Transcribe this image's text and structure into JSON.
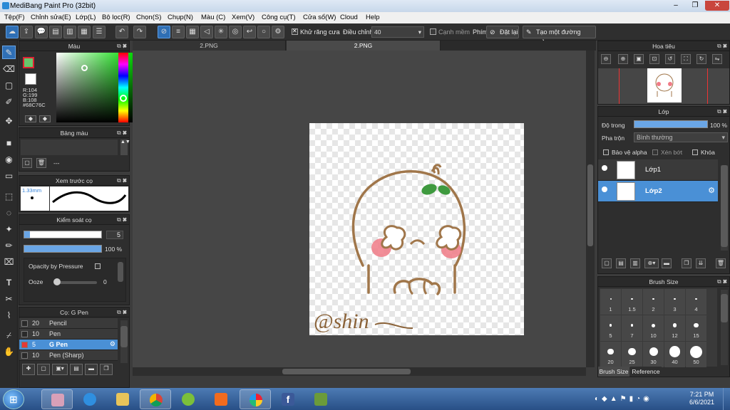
{
  "window": {
    "title": "MediBang Paint Pro (32bit)",
    "min": "–",
    "max": "❐",
    "close": "✕"
  },
  "menu": [
    "Tệp(F)",
    "Chỉnh sửa(E)",
    "Lớp(L)",
    "Bộ lọc(R)",
    "Chọn(S)",
    "Chụp(N)",
    "Màu (C)",
    "Xem(V)",
    "Công cụ(T)",
    "Cửa sổ(W)",
    "Cloud",
    "Help"
  ],
  "toolbar": {
    "antialias_label": "Khử răng cưa",
    "adjust_label": "Điều chỉnh",
    "adjust_value": "40",
    "edge_label": "Cạnh mềm",
    "key_label": "Phím",
    "reset_label": "Đặt lại",
    "straight_label": "Tạo một đường thẳng"
  },
  "color_panel": {
    "title": "Màu",
    "r": "R:104",
    "g": "G:199",
    "b": "B:108",
    "hex": "#68C76C",
    "primary_color": "#68C76C",
    "secondary_color": "#ffffff"
  },
  "palette_panel": {
    "title": "Bảng màu",
    "status": "---"
  },
  "brush_preview": {
    "title": "Xem trước cọ",
    "size": "1.33mm"
  },
  "brush_control": {
    "title": "Kiểm soát cọ",
    "size_value": "5",
    "opacity_value": "100 %",
    "opacity_pressure_label": "Opacity by Pressure",
    "ooze_label": "Ooze",
    "ooze_value": "0",
    "opacity_fraction": 1.0
  },
  "brush_panel": {
    "title": "Cọ: G Pen",
    "items": [
      {
        "size": "20",
        "name": "Pencil",
        "color": "#2a2a2a",
        "selected": false
      },
      {
        "size": "10",
        "name": "Pen",
        "color": "#2a2a2a",
        "selected": false
      },
      {
        "size": "5",
        "name": "G Pen",
        "color": "#e53935",
        "selected": true
      },
      {
        "size": "10",
        "name": "Pen (Sharp)",
        "color": "#2a2a2a",
        "selected": false
      }
    ]
  },
  "tabs": [
    "2.PNG",
    "2.PNG"
  ],
  "navigator": {
    "title": "Hoa tiêu"
  },
  "layer_panel": {
    "title": "Lớp",
    "opacity_label": "Độ trong",
    "opacity_value": "100 %",
    "blend_label": "Pha trộn",
    "blend_value": "Bình thường",
    "protect_alpha": "Bảo vệ alpha",
    "clipping": "Xén bớt",
    "lock": "Khóa",
    "layers": [
      {
        "name": "Lớp1",
        "selected": false
      },
      {
        "name": "Lớp2",
        "selected": true
      }
    ]
  },
  "brush_size_panel": {
    "title": "Brush Size",
    "sizes": [
      "1",
      "1.5",
      "2",
      "3",
      "4",
      "5",
      "7",
      "10",
      "12",
      "15",
      "20",
      "25",
      "30",
      "40",
      "50"
    ],
    "tabs": [
      "Brush Size",
      "Reference"
    ]
  },
  "canvas": {
    "signature": "@shin"
  },
  "taskbar": {
    "time": "7:21 PM",
    "date": "6/6/2021"
  }
}
